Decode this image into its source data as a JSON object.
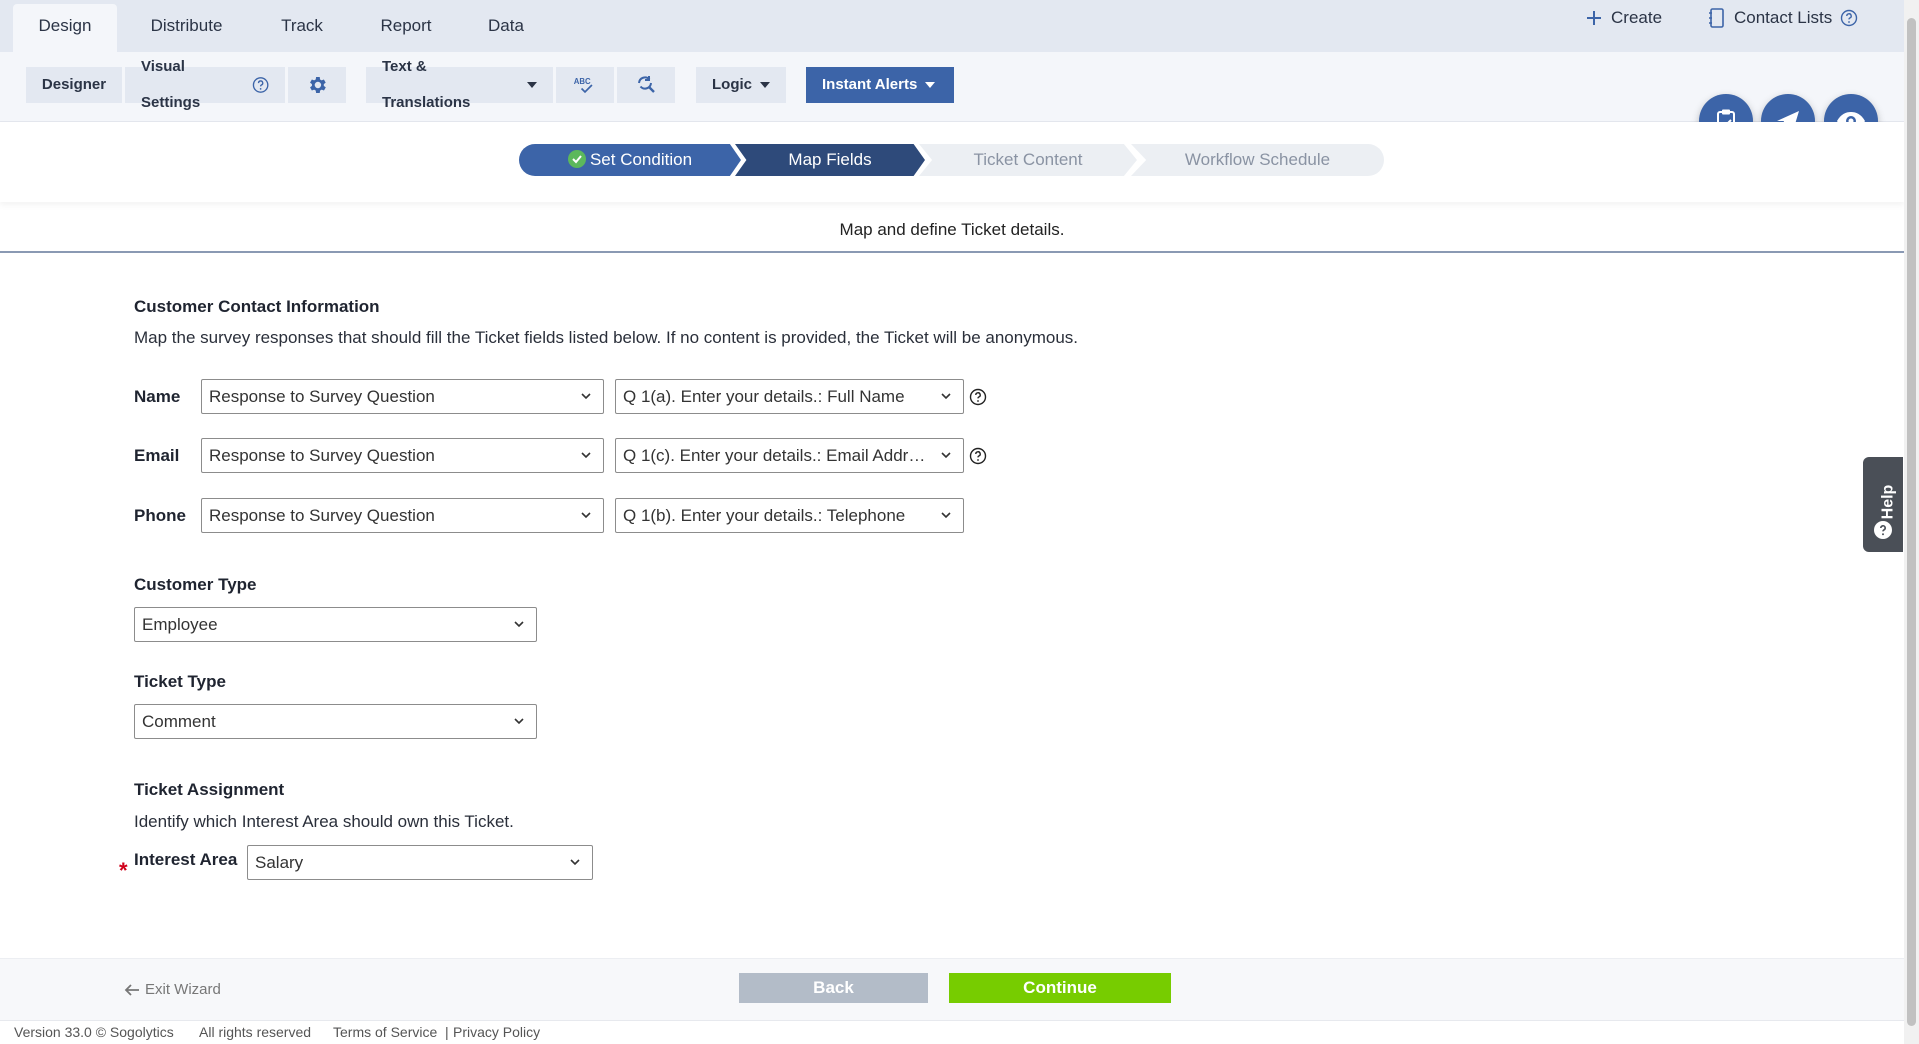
{
  "nav": {
    "tabs": [
      {
        "label": "Design"
      },
      {
        "label": "Distribute"
      },
      {
        "label": "Track"
      },
      {
        "label": "Report"
      },
      {
        "label": "Data"
      }
    ],
    "create_label": "Create",
    "contact_lists_label": "Contact Lists"
  },
  "toolbar": {
    "designer": "Designer",
    "visual_settings": "Visual Settings",
    "text_translations": "Text & Translations",
    "spellcheck_label": "ABC",
    "logic": "Logic",
    "instant_alerts": "Instant Alerts"
  },
  "wizard": {
    "steps": [
      {
        "label": "Set Condition",
        "state": "done"
      },
      {
        "label": "Map Fields",
        "state": "current"
      },
      {
        "label": "Ticket Content",
        "state": "future"
      },
      {
        "label": "Workflow Schedule",
        "state": "future"
      }
    ],
    "subtitle": "Map and define Ticket details."
  },
  "contact": {
    "title": "Customer Contact Information",
    "description": "Map the survey responses that should fill the Ticket fields listed below. If no content is provided, the Ticket will be anonymous.",
    "rows": [
      {
        "label": "Name",
        "source": "Response to Survey Question",
        "question": "Q 1(a). Enter your details.: Full Name"
      },
      {
        "label": "Email",
        "source": "Response to Survey Question",
        "question": "Q 1(c). Enter your details.: Email Addre..."
      },
      {
        "label": "Phone",
        "source": "Response to Survey Question",
        "question": "Q 1(b). Enter your details.: Telephone"
      }
    ]
  },
  "customer_type": {
    "label": "Customer Type",
    "value": "Employee"
  },
  "ticket_type": {
    "label": "Ticket Type",
    "value": "Comment"
  },
  "assignment": {
    "title": "Ticket Assignment",
    "description": "Identify which Interest Area should own this Ticket.",
    "required_mark": "*",
    "interest_label": "Interest Area",
    "interest_value": "Salary"
  },
  "help_tab": "Help",
  "footer": {
    "exit_label": "Exit Wizard",
    "back_label": "Back",
    "continue_label": "Continue",
    "version": "Version 33.0 © Sogolytics",
    "rights": "All rights reserved",
    "terms": "Terms of Service",
    "separator": "|",
    "privacy": "Privacy Policy"
  },
  "colors": {
    "primary": "#3c64a8",
    "step_current": "#2e4a7a",
    "continue": "#77cc00",
    "back": "#b3bcc8",
    "required": "#d0021b",
    "check": "#5cb85c"
  }
}
